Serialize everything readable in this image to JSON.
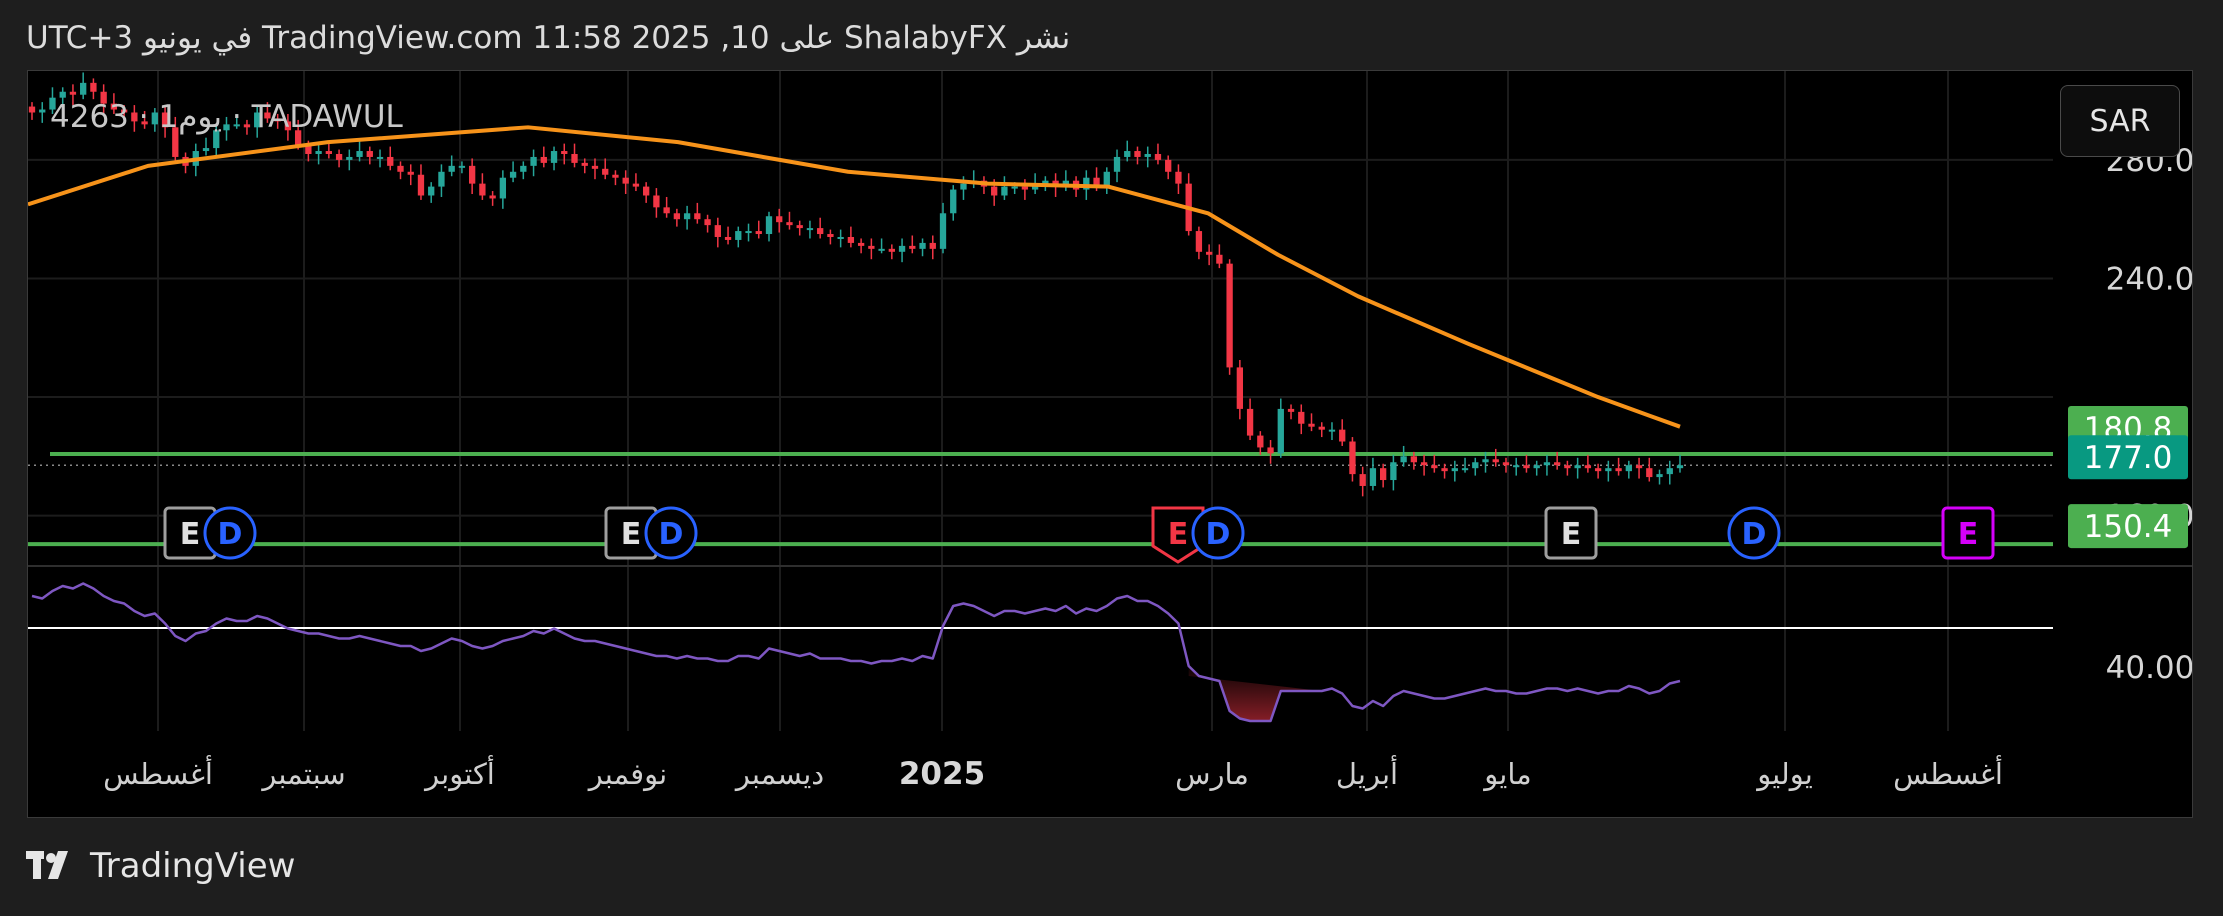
{
  "header": {
    "title": "نشر ShalabyFX على TradingView.com 11:58 2025 ,10 في يونيو UTC+3"
  },
  "symbol": {
    "label": "TADAWUL · يوم1 · 4263"
  },
  "currency": {
    "label": "SAR"
  },
  "footer": {
    "brand": "TradingView"
  },
  "colors": {
    "up": "#26a69a",
    "down": "#f23645",
    "ma": "#f7931a",
    "level": "#4caf50",
    "rsi": "#7e57c2",
    "rsi_line": "#ffffff",
    "last_price": "#089981",
    "earn_default": "#9e9e9e",
    "earn_red": "#f23645",
    "earn_future": "#d500f9",
    "dividend": "#2962ff"
  },
  "chart_data": {
    "type": "candlestick",
    "x_axis": {
      "months": [
        {
          "label": "أغسطس",
          "date": "2024-08"
        },
        {
          "label": "سبتمبر",
          "date": "2024-09"
        },
        {
          "label": "أكتوبر",
          "date": "2024-10"
        },
        {
          "label": "نوفمبر",
          "date": "2024-11"
        },
        {
          "label": "ديسمبر",
          "date": "2024-12"
        },
        {
          "label": "2025",
          "date": "2025-01",
          "year": true
        },
        {
          "label": "مارس",
          "date": "2025-03"
        },
        {
          "label": "أبريل",
          "date": "2025-04"
        },
        {
          "label": "مايو",
          "date": "2025-05"
        },
        {
          "label": "يوليو",
          "date": "2025-07"
        },
        {
          "label": "أغسطس",
          "date": "2025-08"
        }
      ]
    },
    "price_axis": {
      "ticks": [
        "280.0",
        "240.0",
        "160.0"
      ],
      "range": [
        143,
        310
      ]
    },
    "price_levels": [
      {
        "label": "180.8",
        "value": 180.8,
        "style": "level"
      },
      {
        "label": "177.0",
        "value": 177.0,
        "style": "last"
      },
      {
        "label": "150.4",
        "value": 150.4,
        "style": "level"
      }
    ],
    "series": [
      {
        "kind": "candles",
        "closes": [
          296,
          297,
          301,
          303,
          302,
          306,
          303,
          299,
          297,
          296,
          293,
          292,
          296,
          291,
          281,
          278,
          283,
          284,
          290,
          292,
          292,
          291,
          296,
          294,
          293,
          290,
          285,
          282,
          283,
          282,
          280,
          281,
          283,
          281,
          281,
          278,
          276,
          275,
          268,
          271,
          276,
          278,
          278,
          272,
          268,
          267,
          274,
          276,
          278,
          281,
          279,
          283,
          282,
          279,
          278,
          277,
          275,
          274,
          272,
          271,
          268,
          264,
          262,
          260,
          262,
          260,
          258,
          254,
          253,
          256,
          256,
          255,
          261,
          259,
          258,
          257,
          257,
          255,
          254,
          254,
          252,
          251,
          250,
          250,
          249,
          251,
          250,
          252,
          250,
          262,
          270,
          272,
          273,
          271,
          268,
          271,
          271,
          270,
          272,
          273,
          271,
          273,
          270,
          274,
          271,
          276,
          281,
          283,
          281,
          282,
          280,
          276,
          272,
          256,
          249,
          248,
          245,
          210,
          196,
          187,
          183,
          181,
          196,
          195,
          191,
          190,
          189,
          189,
          185,
          174,
          170,
          176,
          172,
          178,
          180,
          178,
          177,
          176,
          175,
          176,
          176,
          178,
          179,
          178,
          177,
          177,
          176,
          177,
          178,
          177,
          176,
          177,
          176,
          175,
          176,
          175,
          177,
          176,
          173,
          174,
          176,
          177
        ],
        "ma200": [
          [
            0,
            265
          ],
          [
            120,
            278
          ],
          [
            300,
            286
          ],
          [
            500,
            291
          ],
          [
            650,
            286
          ],
          [
            820,
            276
          ],
          [
            960,
            272
          ],
          [
            1080,
            271
          ],
          [
            1180,
            262
          ],
          [
            1250,
            248
          ],
          [
            1330,
            234
          ],
          [
            1440,
            218
          ],
          [
            1570,
            200
          ],
          [
            1652,
            190
          ]
        ]
      },
      {
        "kind": "rsi",
        "level": "40.00",
        "values": [
          66,
          65,
          68,
          70,
          69,
          71,
          69,
          66,
          64,
          63,
          60,
          58,
          59,
          55,
          50,
          48,
          51,
          52,
          55,
          57,
          56,
          56,
          58,
          57,
          55,
          53,
          52,
          51,
          51,
          50,
          49,
          49,
          50,
          49,
          48,
          47,
          46,
          46,
          44,
          45,
          47,
          49,
          48,
          46,
          45,
          46,
          48,
          49,
          50,
          52,
          51,
          53,
          51,
          49,
          48,
          48,
          47,
          46,
          45,
          44,
          43,
          42,
          42,
          41,
          42,
          41,
          41,
          40,
          40,
          42,
          42,
          41,
          45,
          44,
          43,
          42,
          43,
          41,
          41,
          41,
          40,
          40,
          39,
          40,
          40,
          41,
          40,
          42,
          41,
          54,
          62,
          63,
          62,
          60,
          58,
          60,
          60,
          59,
          60,
          61,
          60,
          62,
          59,
          61,
          60,
          62,
          65,
          66,
          64,
          64,
          62,
          59,
          55,
          38,
          34,
          33,
          32,
          20,
          17,
          16,
          16,
          16,
          28,
          28,
          28,
          28,
          28,
          29,
          27,
          22,
          21,
          24,
          22,
          26,
          28,
          27,
          26,
          25,
          25,
          26,
          27,
          28,
          29,
          28,
          28,
          27,
          27,
          28,
          29,
          29,
          28,
          29,
          28,
          27,
          28,
          28,
          30,
          29,
          27,
          28,
          31,
          32
        ]
      }
    ],
    "events": [
      {
        "type": "E",
        "state": "past"
      },
      {
        "type": "D",
        "state": "past"
      },
      {
        "type": "E",
        "state": "past"
      },
      {
        "type": "D",
        "state": "past"
      },
      {
        "type": "E",
        "state": "miss"
      },
      {
        "type": "D",
        "state": "past"
      },
      {
        "type": "E",
        "state": "past"
      },
      {
        "type": "D",
        "state": "future"
      },
      {
        "type": "E",
        "state": "future"
      }
    ]
  }
}
